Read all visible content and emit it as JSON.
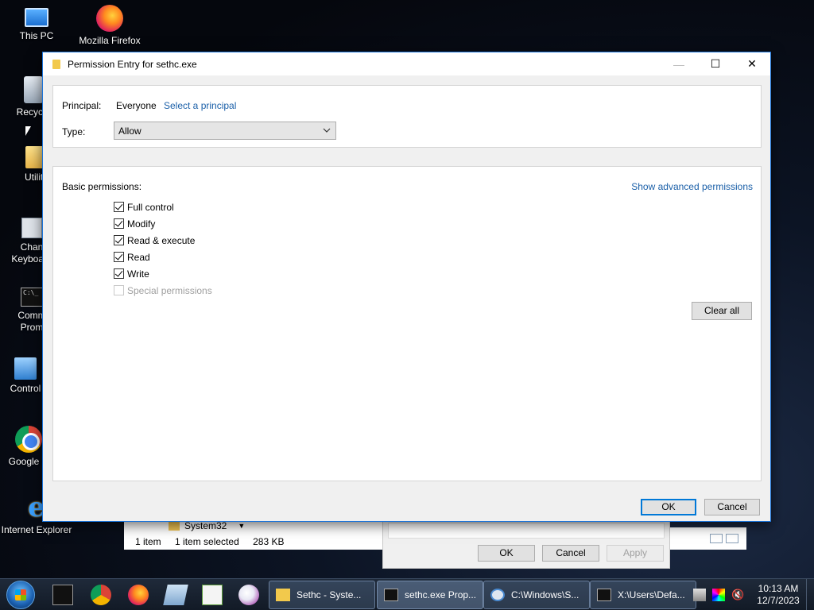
{
  "desktop": {
    "icons": [
      {
        "label": "This PC",
        "icon": "computer-icon"
      },
      {
        "label": "Mozilla Firefox",
        "icon": "firefox-icon"
      },
      {
        "label": "Recycle",
        "icon": "recycle-bin-icon"
      },
      {
        "label": "Utiliti",
        "icon": "folder-icon"
      },
      {
        "label": "Chan",
        "label2": "Keyboard",
        "icon": "settings-icon"
      },
      {
        "label": "Comm",
        "label2": "Prom",
        "icon": "command-prompt-icon"
      },
      {
        "label": "Control",
        "icon": "control-panel-icon"
      },
      {
        "label": "Google C",
        "icon": "chrome-icon"
      },
      {
        "label": "Internet Explorer",
        "icon": "internet-explorer-icon"
      }
    ]
  },
  "background_explorer": {
    "address_folder": "System32",
    "status_items": "1 item",
    "status_selected": "1 item selected",
    "status_size": "283 KB"
  },
  "background_properties": {
    "ok_label": "OK",
    "cancel_label": "Cancel",
    "apply_label": "Apply"
  },
  "dialog": {
    "title": "Permission Entry for sethc.exe",
    "principal_label": "Principal:",
    "principal_value": "Everyone",
    "select_principal_link": "Select a principal",
    "type_label": "Type:",
    "type_value": "Allow",
    "basic_permissions_label": "Basic permissions:",
    "advanced_link": "Show advanced permissions",
    "permissions": [
      {
        "label": "Full control",
        "checked": true,
        "enabled": true
      },
      {
        "label": "Modify",
        "checked": true,
        "enabled": true
      },
      {
        "label": "Read & execute",
        "checked": true,
        "enabled": true
      },
      {
        "label": "Read",
        "checked": true,
        "enabled": true
      },
      {
        "label": "Write",
        "checked": true,
        "enabled": true
      },
      {
        "label": "Special permissions",
        "checked": false,
        "enabled": false
      }
    ],
    "clear_all_label": "Clear all",
    "ok_label": "OK",
    "cancel_label": "Cancel",
    "controls": {
      "minimize": "—",
      "maximize": "☐",
      "close": "✕"
    }
  },
  "taskbar": {
    "pinned": [
      "command-prompt-icon",
      "chrome-icon",
      "firefox-icon",
      "notepad-icon",
      "spreadsheet-icon",
      "paint-icon"
    ],
    "tasks": [
      {
        "label": "Sethc - Syste...",
        "icon": "folder-icon"
      },
      {
        "label": "sethc.exe Prop...",
        "icon": "command-prompt-icon"
      },
      {
        "label": "C:\\Windows\\S...",
        "icon": "settings-icon"
      },
      {
        "label": "X:\\Users\\Defa...",
        "icon": "command-prompt-icon"
      }
    ],
    "clock_time": "10:13 AM",
    "clock_date": "12/7/2023"
  }
}
